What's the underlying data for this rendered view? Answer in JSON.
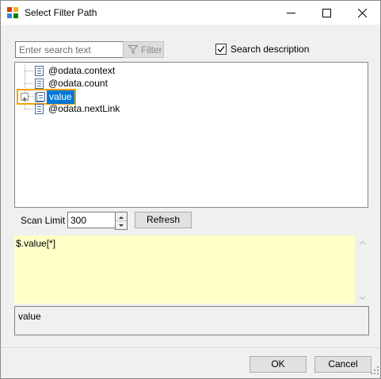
{
  "window": {
    "title": "Select Filter Path"
  },
  "search": {
    "placeholder": "Enter search text",
    "filter_label": "Filter",
    "search_description_label": "Search description",
    "search_description_checked": true
  },
  "tree": {
    "items": [
      {
        "label": "@odata.context",
        "icon": "document-icon"
      },
      {
        "label": "@odata.count",
        "icon": "document-icon"
      },
      {
        "label": "value",
        "icon": "array-icon",
        "expandable": true,
        "selected": true
      },
      {
        "label": "@odata.nextLink",
        "icon": "document-icon"
      }
    ]
  },
  "scan": {
    "label": "Scan Limit",
    "value": "300",
    "refresh_label": "Refresh"
  },
  "path": {
    "expression": "$.value[*]"
  },
  "description": {
    "text": "value"
  },
  "buttons": {
    "ok": "OK",
    "cancel": "Cancel"
  },
  "colors": {
    "selection": "#0078d7",
    "highlight_border": "#f0a30a",
    "path_background": "#ffffc8"
  }
}
